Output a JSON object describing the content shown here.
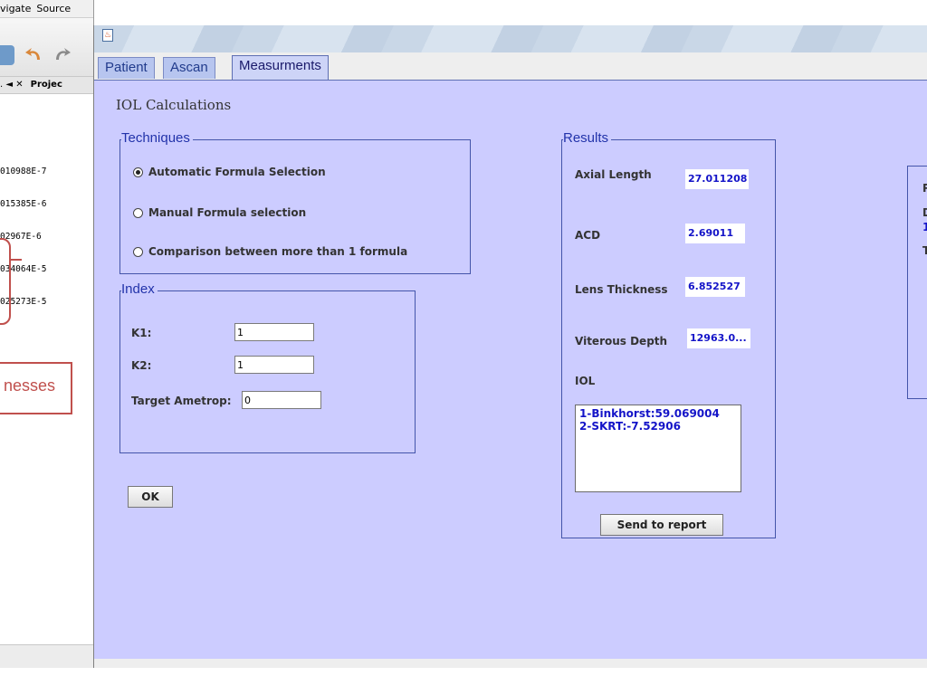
{
  "ide": {
    "menus": [
      "vigate",
      "Source"
    ],
    "tabs": [
      ". ◄ ✕",
      "Projec"
    ],
    "code_lines": [
      "010988E-7",
      "015385E-6",
      "02967E-6",
      "034064E-5",
      "025273E-5"
    ],
    "callout_text": "nesses"
  },
  "window": {
    "tabs": [
      {
        "label": "Patient",
        "active": false
      },
      {
        "label": "Ascan",
        "active": false
      },
      {
        "label": "Measurments",
        "active": true
      }
    ],
    "heading": "IOL Calculations",
    "techniques": {
      "legend": "Techniques",
      "options": [
        {
          "label": "Automatic Formula Selection",
          "selected": true
        },
        {
          "label": "Manual Formula selection",
          "selected": false
        },
        {
          "label": "Comparison between more than 1 formula",
          "selected": false
        }
      ]
    },
    "index": {
      "legend": "Index",
      "k1_label": "K1:",
      "k1_value": "1",
      "k2_label": "K2:",
      "k2_value": "1",
      "target_label": "Target Ametrop:",
      "target_value": "0"
    },
    "ok_label": "OK",
    "results": {
      "legend": "Results",
      "axial_label": "Axial Length",
      "axial_value": "27.011208",
      "acd_label": "ACD",
      "acd_value": "2.69011",
      "lens_label": "Lens Thickness",
      "lens_value": "6.852527",
      "viterous_label": "Viterous Depth",
      "viterous_value": "12963.0...",
      "iol_label": "IOL",
      "iol_lines": [
        "1-Binkhorst:59.069004",
        "2-SKRT:-7.52906"
      ],
      "send_label": "Send to report"
    },
    "clipped_letters": [
      "P",
      "D",
      "1",
      "T"
    ]
  }
}
